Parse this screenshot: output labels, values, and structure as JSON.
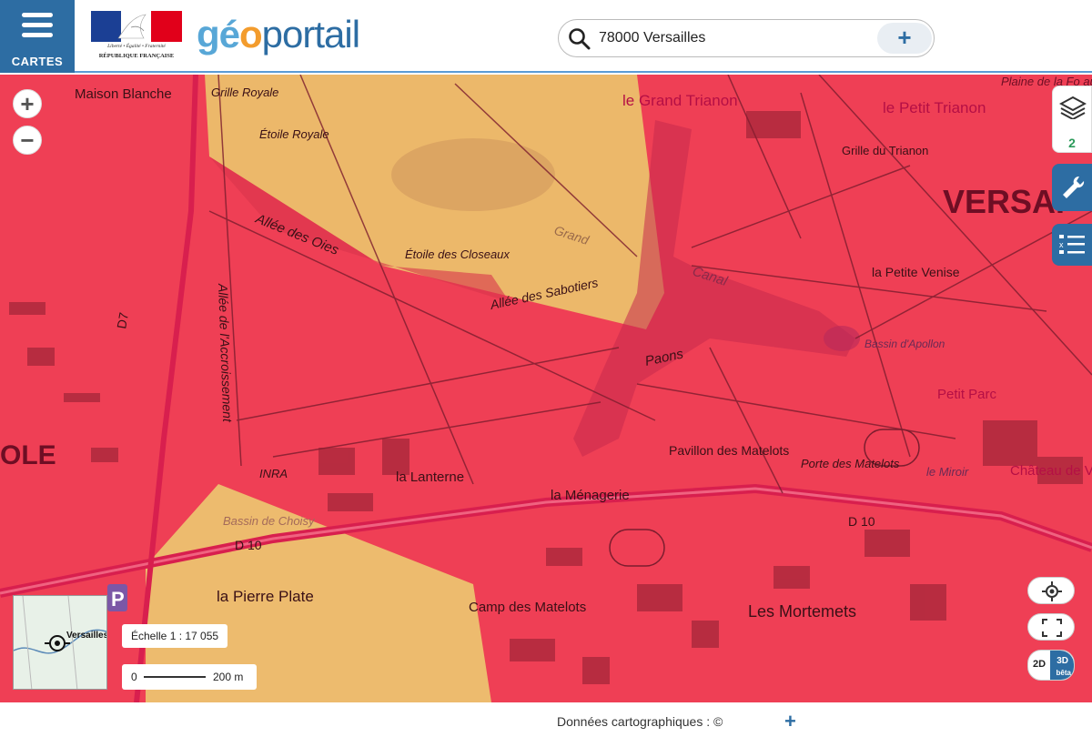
{
  "header": {
    "menu_label": "CARTES",
    "republic_motto": "Liberté • Égalité • Fraternité",
    "republic_name": "RÉPUBLIQUE FRANÇAISE",
    "logo_part1": "gé",
    "logo_part2": "o",
    "logo_part3": "portail",
    "search_value": "78000 Versailles"
  },
  "map": {
    "labels": {
      "maison_blanche": "Maison Blanche",
      "grille_royale": "Grille Royale",
      "etoile_royale": "Étoile Royale",
      "le_grand_trianon": "le Grand Trianon",
      "le_petit_trianon": "le Petit Trianon",
      "grille_du_trianon": "Grille du Trianon",
      "versailles_big": "VERSAI",
      "etoile_des_closeaux": "Étoile des Closeaux",
      "allee_des_sabotiers": "Allée des Sabotiers",
      "la_petite_venise": "la Petite Venise",
      "bassin_apollon": "Bassin d'Apollon",
      "petit_parc": "Petit Parc",
      "pavillon_matelots": "Pavillon des Matelots",
      "porte_matelots": "Porte des Matelots",
      "le_miroir": "le Miroir",
      "chateau": "Château de Versailles",
      "la_lanterne": "la Lanterne",
      "la_menagerie": "la Ménagerie",
      "inra": "INRA",
      "bassin_choisy": "Bassin de Choisy",
      "la_pierre_plate": "la Pierre Plate",
      "camp_matelots": "Camp des Matelots",
      "les_mortemets": "Les Mortemets",
      "grand_canal": "Canal",
      "grand": "Grand",
      "allee_acroissement": "Allée de l'Accroissement",
      "allee_oies": "Allée des Oies",
      "allee_paons": "Paons",
      "d10": "D 10",
      "d7": "D7",
      "ole": "OLE",
      "plaine": "Plaine de la Fo aux Cra"
    },
    "layer_count": "2",
    "overview_label": "Versailles",
    "scale_text": "Échelle 1 : 17 055",
    "scale_bar_start": "0",
    "scale_bar_end": "200 m",
    "toggle_2d": "2D",
    "toggle_3d": "3D",
    "toggle_beta": "bêta"
  },
  "footer": {
    "credit": "Données cartographiques : ©",
    "plus": "+"
  },
  "colors": {
    "brand_blue": "#2d6da3",
    "overlay_red": "#ef3f55",
    "overlay_orange": "#f2a64a"
  }
}
